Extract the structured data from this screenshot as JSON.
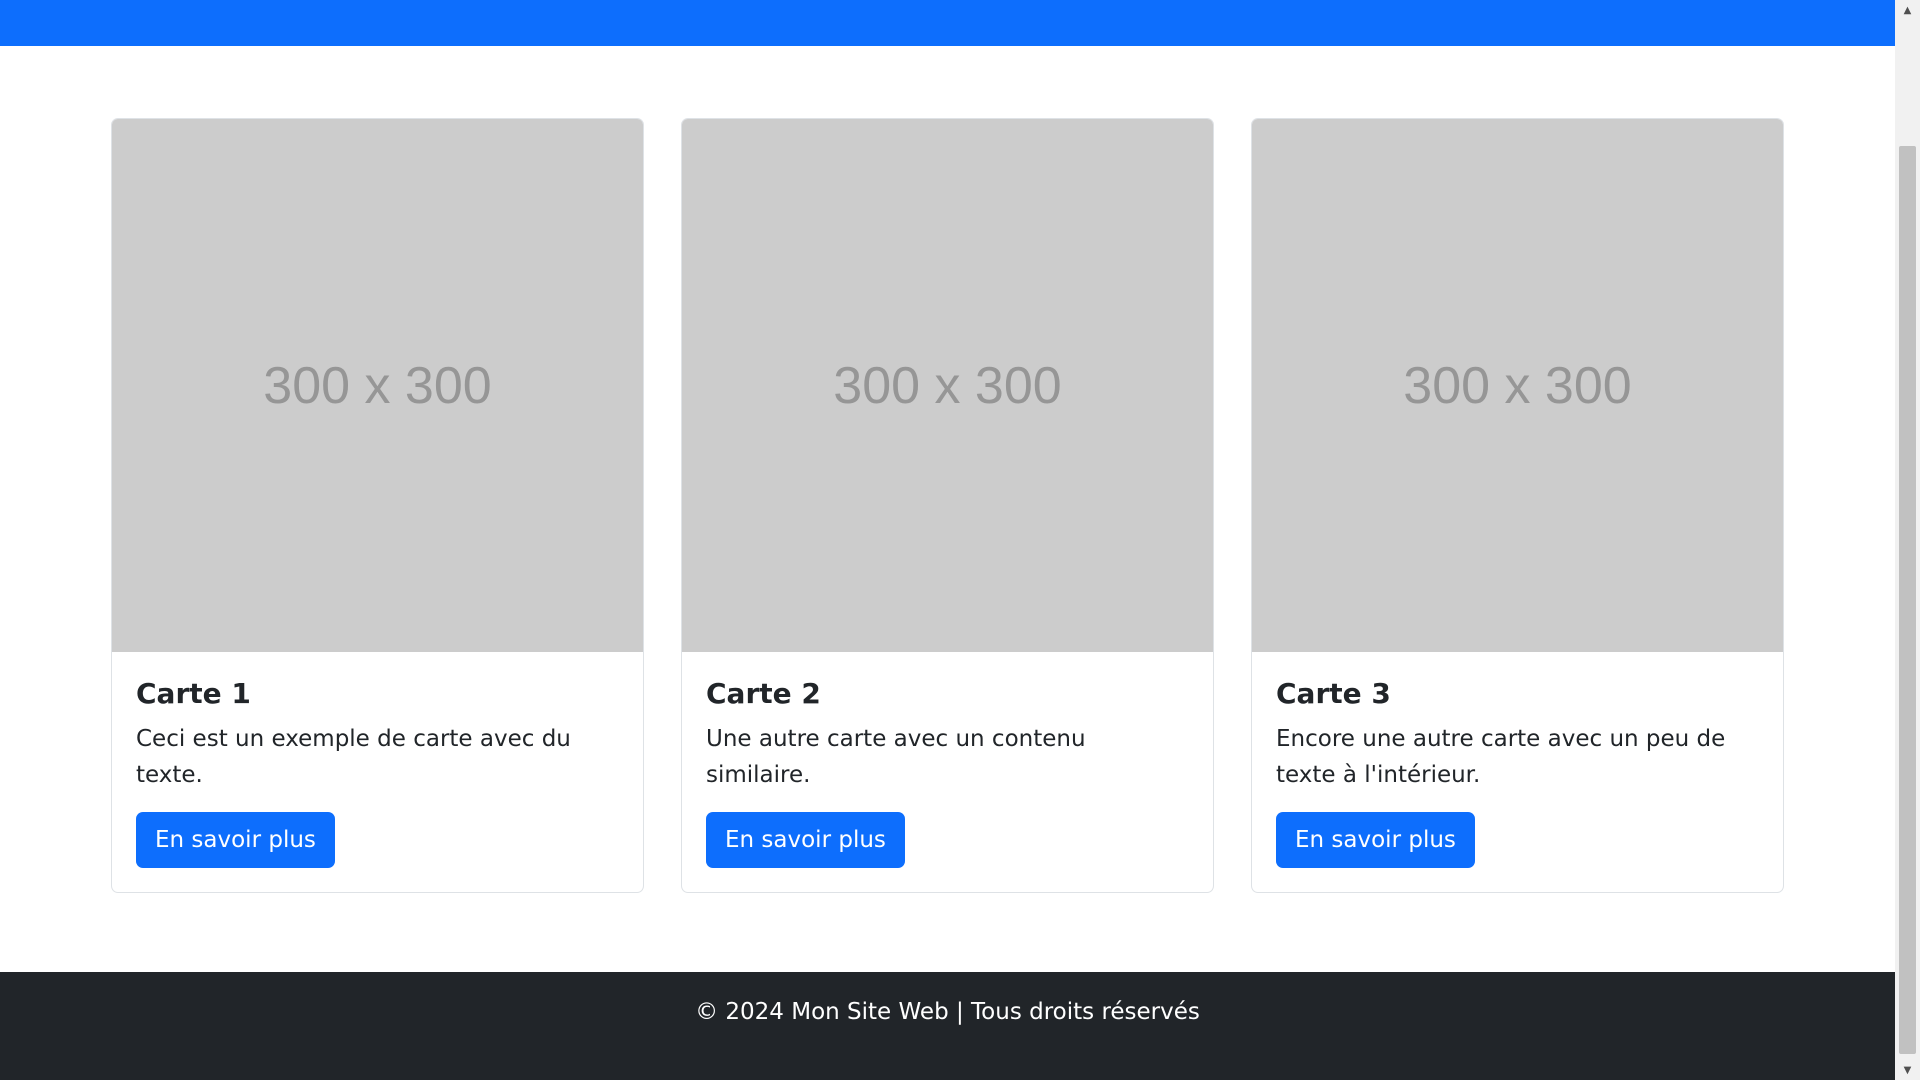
{
  "colors": {
    "primary": "#0d6efd",
    "footer_bg": "#212529",
    "placeholder_bg": "#cccccc"
  },
  "cards": [
    {
      "image_text": "300 x 300",
      "title": "Carte 1",
      "text": "Ceci est un exemple de carte avec du texte.",
      "button_label": "En savoir plus"
    },
    {
      "image_text": "300 x 300",
      "title": "Carte 2",
      "text": "Une autre carte avec un contenu similaire.",
      "button_label": "En savoir plus"
    },
    {
      "image_text": "300 x 300",
      "title": "Carte 3",
      "text": "Encore une autre carte avec un peu de texte à l'intérieur.",
      "button_label": "En savoir plus"
    }
  ],
  "footer": {
    "text": "© 2024 Mon Site Web | Tous droits réservés"
  },
  "scrollbar": {
    "up_icon": "scroll-up-arrow",
    "down_icon": "scroll-down-arrow"
  }
}
